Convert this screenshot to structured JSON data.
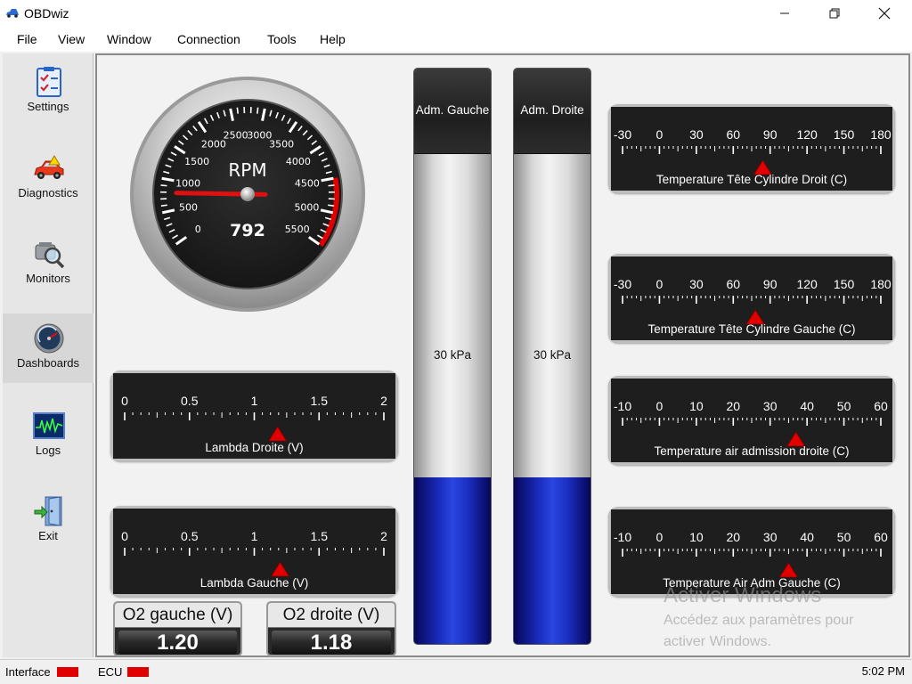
{
  "window": {
    "title": "OBDwiz",
    "minimize_icon": "minimize-icon",
    "maximize_icon": "maximize-icon",
    "close_icon": "close-icon"
  },
  "menu": [
    {
      "label": "File"
    },
    {
      "label": "View"
    },
    {
      "label": "Window"
    },
    {
      "label": "Connection"
    },
    {
      "label": "Tools"
    },
    {
      "label": "Help"
    }
  ],
  "sidebar": {
    "items": [
      {
        "label": "Settings",
        "icon": "checklist-icon"
      },
      {
        "label": "Diagnostics",
        "icon": "car-icon"
      },
      {
        "label": "Monitors",
        "icon": "magnifier-icon"
      },
      {
        "label": "Dashboards",
        "icon": "gauge-icon",
        "active": true
      },
      {
        "label": "Logs",
        "icon": "waveform-icon"
      },
      {
        "label": "Exit",
        "icon": "exit-door-icon"
      }
    ]
  },
  "rpm_gauge": {
    "label": "RPM",
    "value": "792",
    "needle_value": 792,
    "max": 5500,
    "redline_start": 4500,
    "ticks": [
      "0",
      "500",
      "1000",
      "1500",
      "2000",
      "2500",
      "3000",
      "3500",
      "4000",
      "4500",
      "5000",
      "5500"
    ]
  },
  "linear_gauges": [
    {
      "title": "Temperature Tête Cylindre Droit (C)",
      "ticks": [
        "-30",
        "0",
        "30",
        "60",
        "90",
        "120",
        "150",
        "180"
      ],
      "min": -30,
      "max": 180,
      "value": 84
    },
    {
      "title": "Temperature Tête Cylindre Gauche (C)",
      "ticks": [
        "-30",
        "0",
        "30",
        "60",
        "90",
        "120",
        "150",
        "180"
      ],
      "min": -30,
      "max": 180,
      "value": 78
    },
    {
      "title": "Temperature air admission droite (C)",
      "ticks": [
        "-10",
        "0",
        "10",
        "20",
        "30",
        "40",
        "50",
        "60"
      ],
      "min": -10,
      "max": 60,
      "value": 37
    },
    {
      "title": "Temperature Air Adm Gauche (C)",
      "ticks": [
        "-10",
        "0",
        "10",
        "20",
        "30",
        "40",
        "50",
        "60"
      ],
      "min": -10,
      "max": 60,
      "value": 35
    },
    {
      "title": "Lambda Droite (V)",
      "ticks": [
        "0",
        "0.5",
        "1",
        "1.5",
        "2"
      ],
      "min": 0,
      "max": 2,
      "value": 1.18
    },
    {
      "title": "Lambda Gauche (V)",
      "ticks": [
        "0",
        "0.5",
        "1",
        "1.5",
        "2"
      ],
      "min": 0,
      "max": 2,
      "value": 1.2
    }
  ],
  "tanks": [
    {
      "title": "Adm. Gauche",
      "value_text": "30 kPa",
      "fill_fraction": 0.29
    },
    {
      "title": "Adm. Droite",
      "value_text": "30 kPa",
      "fill_fraction": 0.29
    }
  ],
  "digital": [
    {
      "label": "O2 gauche (V)",
      "value": "1.20"
    },
    {
      "label": "O2 droite (V)",
      "value": "1.18"
    }
  ],
  "watermark": {
    "title": "Activer Windows",
    "line1": "Accédez aux paramètres pour",
    "line2": "activer Windows."
  },
  "status": {
    "interface_label": "Interface",
    "ecu_label": "ECU",
    "time": "5:02 PM",
    "led_color": "#e00000"
  },
  "colors": {
    "needle": "#e01010",
    "redline": "#e00000",
    "marker": "#e00000",
    "tank_fill": "#1b2fc2"
  }
}
